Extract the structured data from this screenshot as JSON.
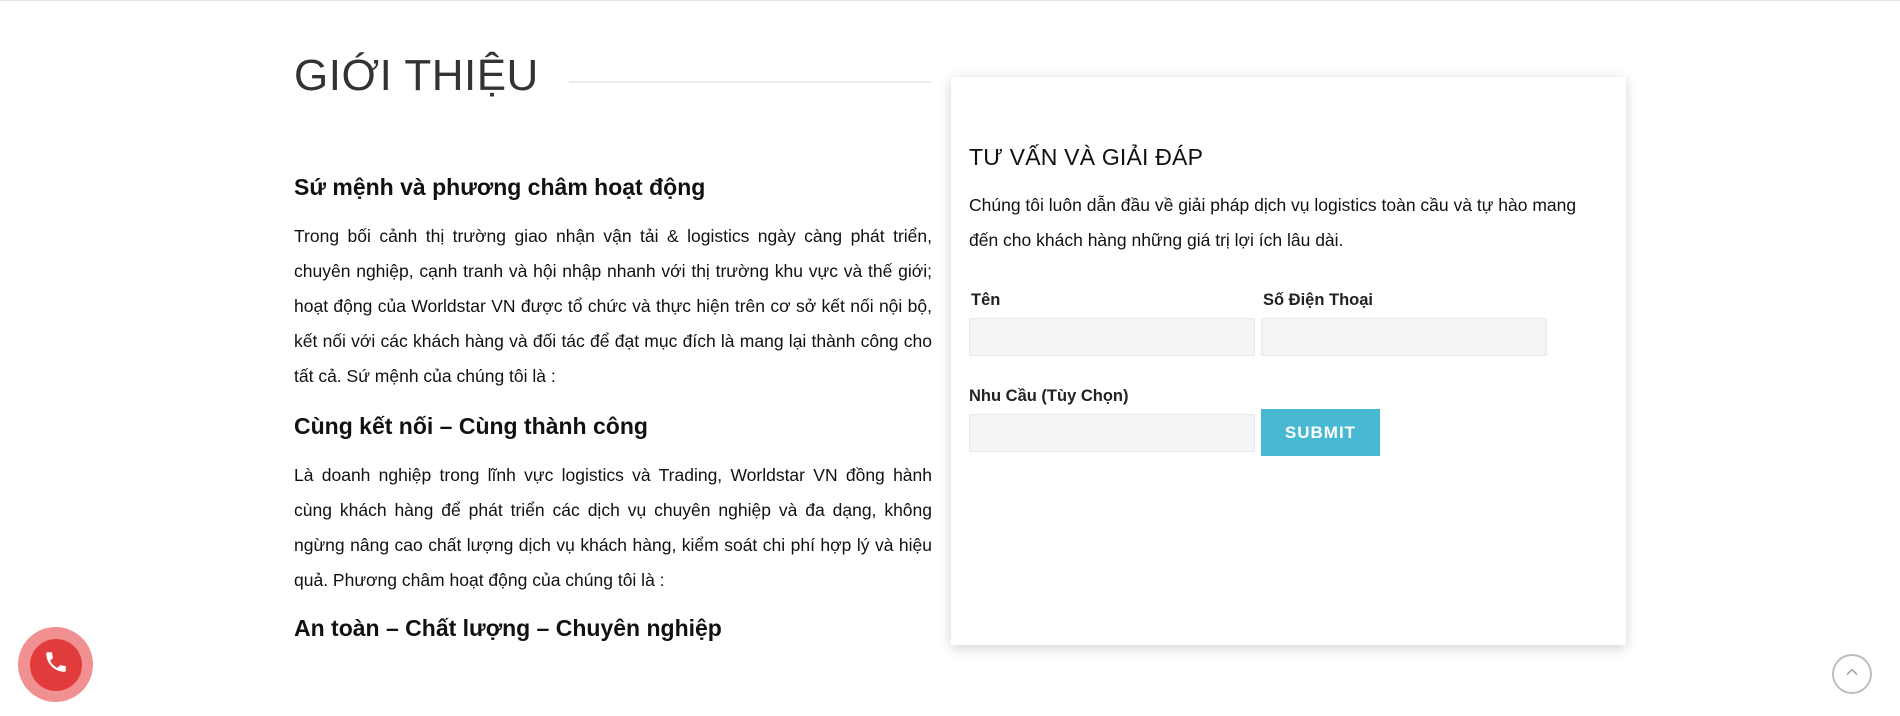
{
  "intro": {
    "section_title": "GIỚI THIỆU",
    "mission_heading": "Sứ mệnh và phương châm hoạt động",
    "paragraph_1": "Trong bối cảnh thị trường giao nhận vận tải & logistics ngày càng phát triển, chuyên nghiệp, cạnh tranh và hội nhập nhanh với thị trường khu vực và thế giới; hoạt động của Worldstar VN được tổ chức và thực hiện trên cơ sở kết nối nội bộ, kết nối với các khách hàng và đối tác để đạt mục đích là mang lại thành công cho tất cả. Sứ mệnh của chúng tôi là :",
    "slogan_1": "Cùng kết nối – Cùng thành công",
    "paragraph_2": "Là doanh nghiệp trong lĩnh vực logistics và Trading, Worldstar VN đồng hành cùng khách hàng để phát triển các dịch vụ chuyên nghiệp và đa dạng, không ngừng nâng cao chất lượng dịch vụ khách hàng, kiểm soát chi phí hợp lý và hiệu quả. Phương châm hoạt động của chúng tôi là :",
    "slogan_2": "An toàn – Chất lượng – Chuyên nghiệp"
  },
  "consult_form": {
    "title": "TƯ VẤN VÀ GIẢI ĐÁP",
    "description": "Chúng tôi luôn dẫn đầu về giải pháp dịch vụ logistics toàn cầu và tự hào mang đến cho khách hàng những giá trị lợi ích lâu dài.",
    "name_label": "Tên",
    "name_value": "",
    "phone_label": "Số Điện Thoại",
    "phone_value": "",
    "need_label": "Nhu Cầu (Tùy Chọn)",
    "need_value": "",
    "submit_label": "SUBMIT"
  },
  "colors": {
    "submit_bg": "#48b9d3",
    "call_button": "#e23b3b"
  },
  "icons": {
    "call": "phone-icon",
    "back_to_top": "chevron-up-icon"
  }
}
